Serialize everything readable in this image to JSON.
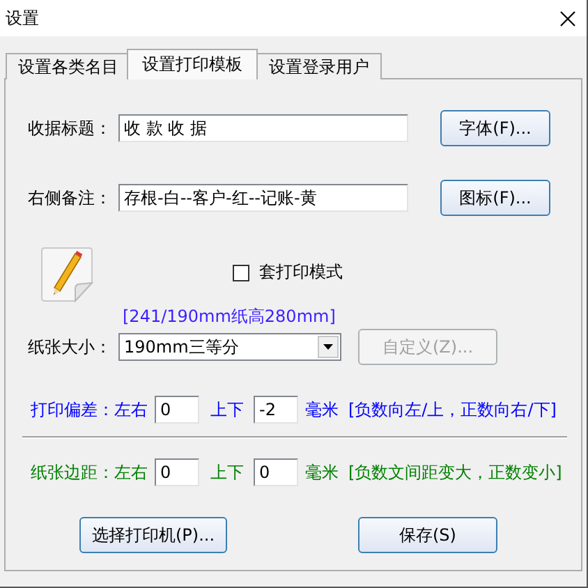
{
  "window": {
    "title": "设置"
  },
  "tabs": [
    {
      "label": "设置各类名目",
      "selected": false
    },
    {
      "label": "设置打印模板",
      "selected": true
    },
    {
      "label": "设置登录用户",
      "selected": false
    }
  ],
  "fields": [
    {
      "label": "收据标题：",
      "value": "收 款 收 据",
      "button": "字体(F)..."
    },
    {
      "label": "右侧备注：",
      "value": "存根-白--客户-红--记账-黄",
      "button": "图标(F)..."
    }
  ],
  "overprint": {
    "label": "套打印模式",
    "checked": false
  },
  "paper_info": "[241/190mm纸高280mm]",
  "paper_size": {
    "label": "纸张大小：",
    "value": "190mm三等分",
    "button": {
      "label": "自定义(Z)...",
      "disabled": true
    }
  },
  "adjust_rows": [
    {
      "label": "打印偏差：左右",
      "color": "#0000ff",
      "horizontal": "0",
      "vertical_label": "上下",
      "vertical": "-2",
      "unit": "毫米",
      "note": "[负数向左/上，正数向右/下]"
    },
    {
      "label": "纸张边距：左右",
      "color": "#008000",
      "horizontal": "0",
      "vertical_label": "上下",
      "vertical": "0",
      "unit": "毫米",
      "note": "[负数文间距变大，正数变小]"
    }
  ],
  "buttons": [
    {
      "label": "选择打印机(P)..."
    },
    {
      "label": "保存(S)"
    }
  ]
}
